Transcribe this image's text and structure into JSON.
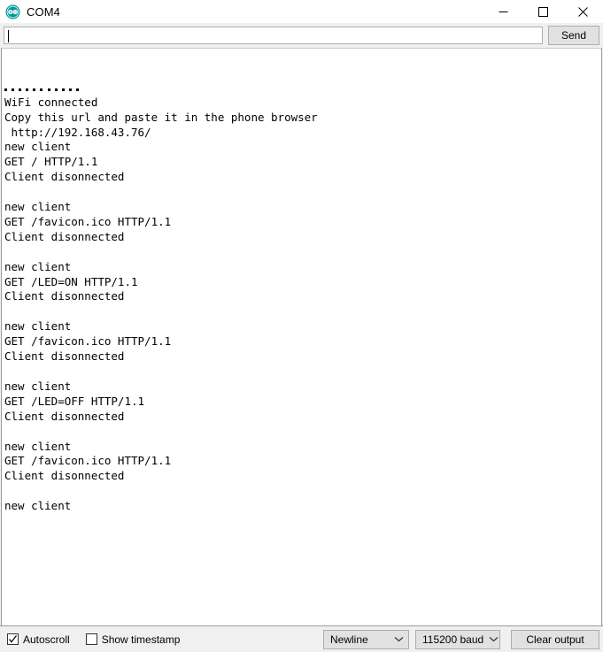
{
  "window": {
    "title": "COM4",
    "logo_icon": "arduino-logo-icon",
    "minimize_icon": "minimize-icon",
    "maximize_icon": "maximize-icon",
    "close_icon": "close-icon"
  },
  "send_row": {
    "input_value": "",
    "input_placeholder": "",
    "send_label": "Send"
  },
  "console": {
    "leading_dots": 11,
    "lines": [
      "WiFi connected",
      "Copy this url and paste it in the phone browser",
      " http://192.168.43.76/",
      "new client",
      "GET / HTTP/1.1",
      "Client disonnected",
      "",
      "new client",
      "GET /favicon.ico HTTP/1.1",
      "Client disonnected",
      "",
      "new client",
      "GET /LED=ON HTTP/1.1",
      "Client disonnected",
      "",
      "new client",
      "GET /favicon.ico HTTP/1.1",
      "Client disonnected",
      "",
      "new client",
      "GET /LED=OFF HTTP/1.1",
      "Client disonnected",
      "",
      "new client",
      "GET /favicon.ico HTTP/1.1",
      "Client disonnected",
      "",
      "new client"
    ]
  },
  "status_bar": {
    "autoscroll_label": "Autoscroll",
    "autoscroll_checked": true,
    "show_timestamp_label": "Show timestamp",
    "show_timestamp_checked": false,
    "line_ending_value": "Newline",
    "baud_value": "115200 baud",
    "clear_output_label": "Clear output"
  },
  "colors": {
    "arduino_teal": "#00979c",
    "window_bg": "#f0f0f0",
    "console_bg": "#ffffff",
    "text": "#000000",
    "button_face": "#e1e1e1",
    "button_border": "#adadad"
  }
}
